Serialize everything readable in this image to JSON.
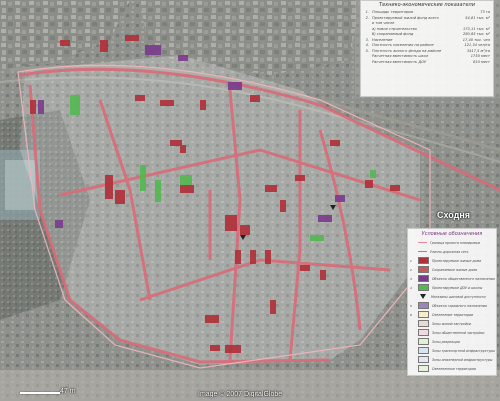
{
  "map": {
    "place_label": "Сходня",
    "scale_label": "47 m",
    "attribution": "Image © 2007 DigitalGlobe"
  },
  "colors": {
    "road": "#d96b78",
    "boundary": "#e58a96",
    "residential": "#b0313a",
    "public": "#7a3b8c",
    "greenery": "#53b84f",
    "panel_bg": "#ffffff"
  },
  "teps": {
    "title": "Технико-экономические показатели",
    "rows": [
      {
        "n": "1.",
        "label": "Площадь территории",
        "value": "73 га"
      },
      {
        "n": "2.",
        "label": "Проектируемый жилой фонд всего",
        "value": "54,81 тыс. м²"
      },
      {
        "n": "",
        "label": "в том числе",
        "value": ""
      },
      {
        "n": "",
        "label": "а) новое строительство",
        "value": "173,11 тыс. м²"
      },
      {
        "n": "",
        "label": "б) сохраняемый фонд",
        "value": "280,65 тыс. м²"
      },
      {
        "n": "3.",
        "label": "Население",
        "value": "17,40 тыс. чел"
      },
      {
        "n": "4.",
        "label": "Плотность населения на районе",
        "value": "121,34 чел/га"
      },
      {
        "n": "5.",
        "label": "Плотность жилого фонда на районе",
        "value": "3417,5 м²/га"
      },
      {
        "n": "",
        "label": "Расчетная вместимость школ",
        "value": "1730 мест"
      },
      {
        "n": "",
        "label": "Расчетная вместимость ДОУ",
        "value": "810 мест"
      }
    ]
  },
  "legend": {
    "title": "Условные обозначения",
    "items": [
      {
        "n": "",
        "label": "Граница проекта планировки",
        "color": "#e58a96",
        "kind": "line"
      },
      {
        "n": "",
        "label": "Улично-дорожная сеть",
        "color": "#d96b78",
        "kind": "line"
      },
      {
        "n": "1",
        "label": "Проектируемые жилые дома",
        "color": "#b0313a",
        "kind": "box"
      },
      {
        "n": "2",
        "label": "Сохраняемые жилые дома",
        "color": "#c45a5a",
        "kind": "box"
      },
      {
        "n": "3",
        "label": "Объекты общественного назначения",
        "color": "#7a3b8c",
        "kind": "box"
      },
      {
        "n": "4",
        "label": "Проектируемые ДОУ и школы",
        "color": "#53b84f",
        "kind": "box"
      },
      {
        "n": "",
        "label": "Магазины шаговой доступности",
        "color": "#222222",
        "kind": "tri"
      },
      {
        "n": "5",
        "label": "Объекты гаражного назначения",
        "color": "#9b86b5",
        "kind": "box"
      },
      {
        "n": "6",
        "label": "Озеленение территории",
        "color": "#f5efc8",
        "kind": "box"
      },
      {
        "n": "",
        "label": "Зоны жилой застройки",
        "color": "#eadbd2",
        "kind": "box"
      },
      {
        "n": "",
        "label": "Зоны общественной застройки",
        "color": "#f2d9e0",
        "kind": "box"
      },
      {
        "n": "",
        "label": "Зоны рекреации",
        "color": "#dff0d5",
        "kind": "box"
      },
      {
        "n": "",
        "label": "Зоны транспортной инфраструктуры",
        "color": "#d7e3ef",
        "kind": "box"
      },
      {
        "n": "",
        "label": "Зоны инженерной инфраструктуры",
        "color": "#e8e4f0",
        "kind": "box"
      },
      {
        "n": "",
        "label": "Озелененные территории",
        "color": "#e6f2dc",
        "kind": "box"
      }
    ]
  }
}
